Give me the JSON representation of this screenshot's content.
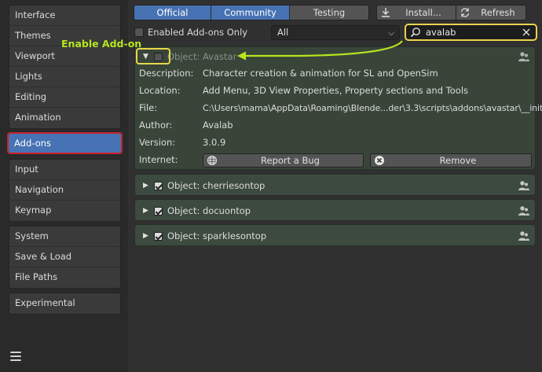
{
  "sidebar": {
    "groups": [
      [
        "Interface",
        "Themes",
        "Viewport",
        "Lights",
        "Editing",
        "Animation"
      ],
      [
        "Add-ons"
      ],
      [
        "Input",
        "Navigation",
        "Keymap"
      ],
      [
        "System",
        "Save & Load",
        "File Paths"
      ],
      [
        "Experimental"
      ]
    ],
    "active": "Add-ons"
  },
  "toolbar": {
    "tabs": [
      "Official",
      "Community",
      "Testing"
    ],
    "active_tabs": [
      "Official",
      "Community"
    ],
    "install_label": "Install...",
    "refresh_label": "Refresh"
  },
  "filter": {
    "enabled_only_label": "Enabled Add-ons Only",
    "category_value": "All",
    "search_value": "avalab"
  },
  "annotation": {
    "label": "Enable Add-on",
    "color": "#b5e61d"
  },
  "addon": {
    "name": "Object: Avastar",
    "enabled": false,
    "details": {
      "description": {
        "key": "Description:",
        "value": "Character creation & animation for SL and OpenSim"
      },
      "location": {
        "key": "Location:",
        "value": "Add Menu, 3D View Properties, Property sections and Tools"
      },
      "file": {
        "key": "File:",
        "value": "C:\\Users\\mama\\AppData\\Roaming\\Blende...der\\3.3\\scripts\\addons\\avastar\\__init__.py"
      },
      "author": {
        "key": "Author:",
        "value": "Avalab"
      },
      "version": {
        "key": "Version:",
        "value": "3.0.9"
      },
      "internet": {
        "key": "Internet:"
      }
    },
    "report_bug_label": "Report a Bug",
    "remove_label": "Remove"
  },
  "other_addons": [
    {
      "name": "Object: cherriesontop",
      "enabled": true
    },
    {
      "name": "Object: docuontop",
      "enabled": true
    },
    {
      "name": "Object: sparklesontop",
      "enabled": true
    }
  ],
  "colors": {
    "accent": "#4772b3",
    "highlight_red": "#c8232b",
    "highlight_yellow": "#e8d54a",
    "addon_panel": "#3d4a3f"
  }
}
